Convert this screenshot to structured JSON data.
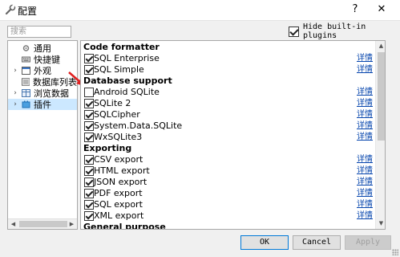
{
  "window": {
    "title": "配置",
    "help_glyph": "?",
    "close_glyph": "✕"
  },
  "search": {
    "placeholder": "搜索"
  },
  "hide_builtin": {
    "label": "Hide built-in plugins",
    "checked": true
  },
  "tree": {
    "items": [
      {
        "label": "通用",
        "icon": "settings-icon",
        "expander": ""
      },
      {
        "label": "快捷键",
        "icon": "keyboard-icon",
        "expander": ""
      },
      {
        "label": "外观",
        "icon": "appearance-icon",
        "expander": "›"
      },
      {
        "label": "数据库列表",
        "icon": "database-list-icon",
        "expander": ""
      },
      {
        "label": "浏览数据",
        "icon": "browse-data-icon",
        "expander": "›"
      },
      {
        "label": "插件",
        "icon": "plugin-icon",
        "expander": "›",
        "selected": true
      }
    ],
    "scroll_left": "◀",
    "scroll_right": "▶"
  },
  "plugins": {
    "details_label": "详情",
    "groups": [
      {
        "title": "Code formatter",
        "items": [
          {
            "name": "SQL Enterprise",
            "checked": true
          },
          {
            "name": "SQL Simple",
            "checked": true
          }
        ]
      },
      {
        "title": "Database support",
        "items": [
          {
            "name": "Android SQLite",
            "checked": false
          },
          {
            "name": "SQLite 2",
            "checked": true
          },
          {
            "name": "SQLCipher",
            "checked": true
          },
          {
            "name": "System.Data.SQLite",
            "checked": true
          },
          {
            "name": "WxSQLite3",
            "checked": true
          }
        ]
      },
      {
        "title": "Exporting",
        "items": [
          {
            "name": "CSV export",
            "checked": true
          },
          {
            "name": "HTML export",
            "checked": true
          },
          {
            "name": "JSON export",
            "checked": true
          },
          {
            "name": "PDF export",
            "checked": true
          },
          {
            "name": "SQL export",
            "checked": true
          },
          {
            "name": "XML export",
            "checked": true
          }
        ]
      },
      {
        "title": "General purpose",
        "items": []
      }
    ],
    "scroll_up": "▲",
    "scroll_down": "▼"
  },
  "buttons": {
    "ok": "OK",
    "cancel": "Cancel",
    "apply": "Apply"
  },
  "colors": {
    "link": "#0645ad",
    "selection": "#cce8ff",
    "annotation_arrow": "#e02020"
  }
}
